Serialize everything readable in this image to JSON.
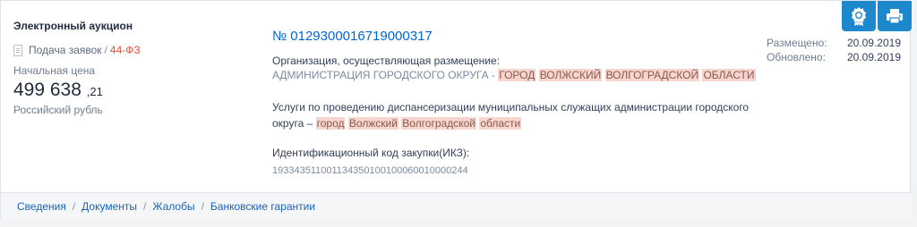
{
  "lot": {
    "type": "Электронный аукцион",
    "stage": "Подача заявок",
    "stage_separator": "/",
    "law": "44-ФЗ",
    "price_label": "Начальная цена",
    "price_main": "499 638",
    "price_fraction": ",21",
    "currency": "Российский рубль"
  },
  "tender": {
    "number": "№ 0129300016719000317",
    "org_label": "Организация, осуществляющая размещение:",
    "org_name_plain": "АДМИНИСТРАЦИЯ ГОРОДСКОГО ОКРУГА -",
    "org_name_highlight": [
      "ГОРОД",
      "ВОЛЖСКИЙ",
      "ВОЛГОГРАДСКОЙ",
      "ОБЛАСТИ"
    ],
    "subject_plain": "Услуги по проведению диспансеризации муниципальных служащих администрации городского округа –",
    "subject_highlight": [
      "город",
      "Волжский",
      "Волгоградской",
      "области"
    ],
    "ikz_label": "Идентификационный код закупки(ИКЗ):",
    "ikz": "193343511001134350100100060010000244"
  },
  "dates": [
    {
      "label": "Размещено:",
      "value": "20.09.2019"
    },
    {
      "label": "Обновлено:",
      "value": "20.09.2019"
    }
  ],
  "actions": [
    {
      "icon": "award-icon",
      "color": "#1e88cc"
    },
    {
      "icon": "printer-icon",
      "color": "#1e88cc"
    }
  ],
  "footer_links": [
    "Сведения",
    "Документы",
    "Жалобы",
    "Банковские гарантии"
  ],
  "colors": {
    "accent": "#1e88cc",
    "link": "#0065dd",
    "law": "#e64d3d",
    "highlight": "#f8d5ce"
  }
}
